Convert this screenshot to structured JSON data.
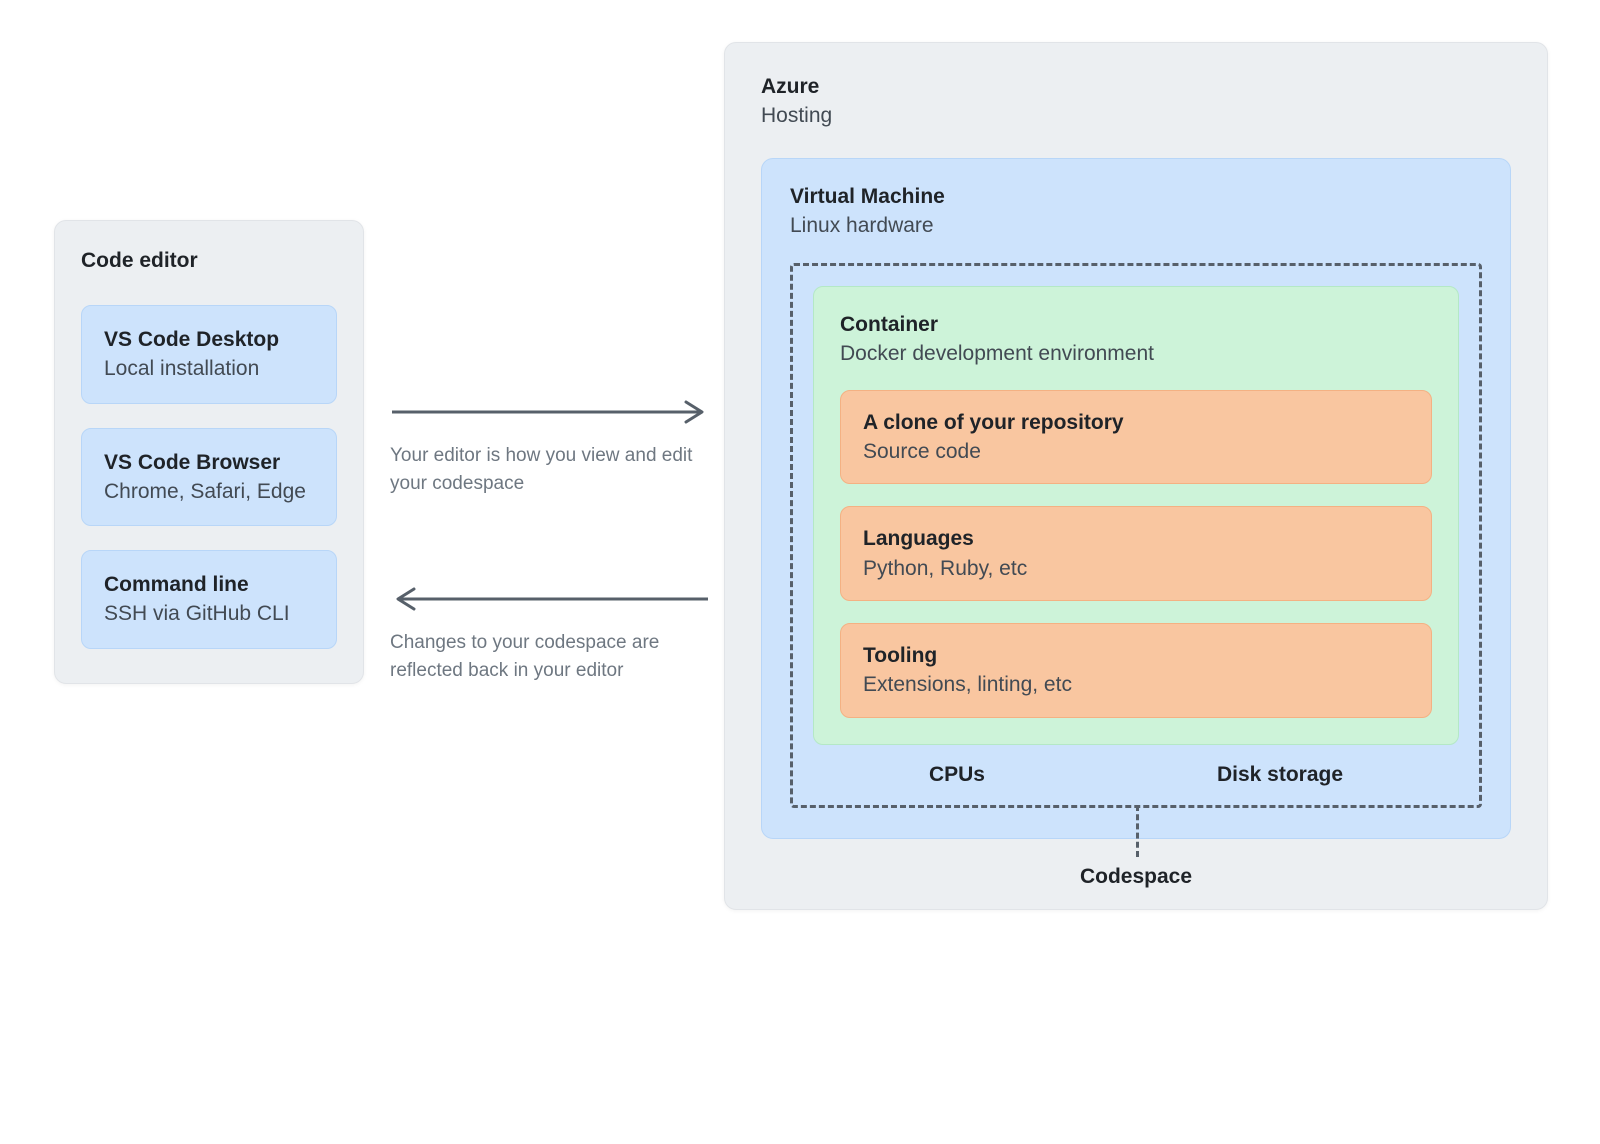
{
  "editor": {
    "panel_title": "Code editor",
    "options": [
      {
        "title": "VS Code Desktop",
        "subtitle": "Local installation"
      },
      {
        "title": "VS Code Browser",
        "subtitle": "Chrome, Safari, Edge"
      },
      {
        "title": "Command line",
        "subtitle": "SSH via GitHub CLI"
      }
    ]
  },
  "arrows": {
    "to_right": "Your editor is how you view and edit your codespace",
    "to_left": "Changes to your codespace are reflected back in your editor"
  },
  "azure": {
    "title": "Azure",
    "subtitle": "Hosting",
    "vm": {
      "title": "Virtual Machine",
      "subtitle": "Linux hardware",
      "container": {
        "title": "Container",
        "subtitle": "Docker development environment",
        "items": [
          {
            "title": "A clone of your repository",
            "subtitle": "Source code"
          },
          {
            "title": "Languages",
            "subtitle": "Python, Ruby, etc"
          },
          {
            "title": "Tooling",
            "subtitle": "Extensions, linting, etc"
          }
        ]
      },
      "resources": {
        "cpus": "CPUs",
        "disk": "Disk storage"
      },
      "codespace_label": "Codespace"
    }
  }
}
